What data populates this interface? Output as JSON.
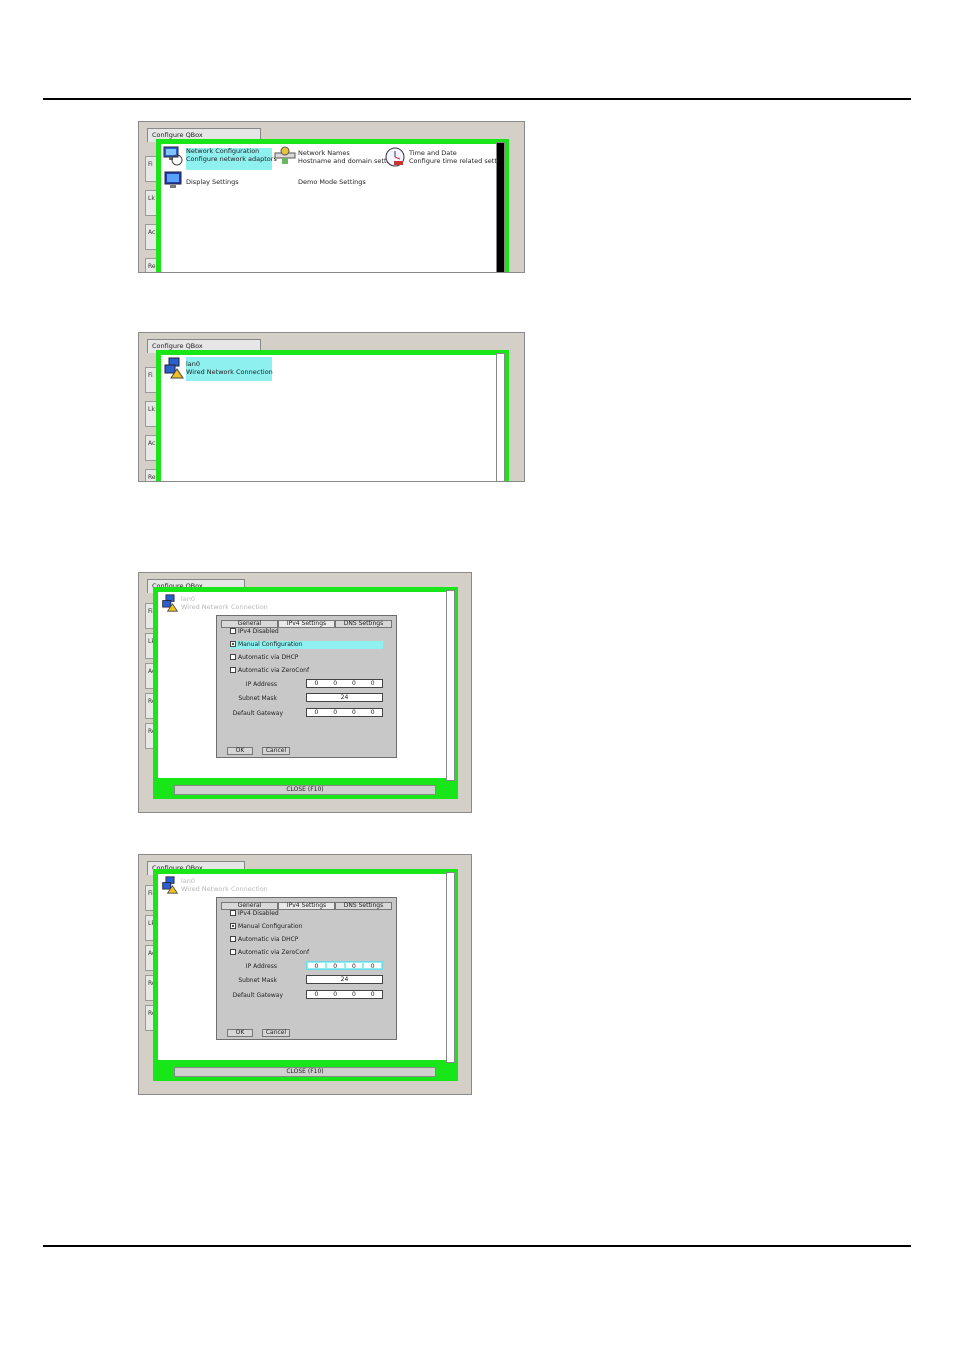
{
  "window_title": "Configure QBox",
  "side_tabs": [
    "Fi",
    "Lk",
    "Ac",
    "Re",
    "Re"
  ],
  "shot1": {
    "items": [
      {
        "title": "Network Configuration",
        "subtitle": "Configure network adaptors",
        "icon": "network-config-icon"
      },
      {
        "title": "Network Names",
        "subtitle": "Hostname and domain settin",
        "icon": "network-names-icon"
      },
      {
        "title": "Time and Date",
        "subtitle": "Configure time related settin",
        "icon": "clock-icon"
      },
      {
        "title": "Display Settings",
        "subtitle": "",
        "icon": "monitor-icon"
      },
      {
        "title": "Demo Mode Settings",
        "subtitle": "",
        "icon": ""
      }
    ]
  },
  "shot2": {
    "item": {
      "title": "lan0",
      "subtitle": "Wired Network Connection",
      "icon": "network-warning-icon"
    }
  },
  "dialog": {
    "conn_title": "lan0",
    "conn_subtitle": "Wired Network Connection",
    "tabs": [
      "General",
      "IPv4 Settings",
      "DNS Settings"
    ],
    "options": [
      "IPv4 Disabled",
      "Manual Configuration",
      "Automatic via DHCP",
      "Automatic via ZeroConf"
    ],
    "ip_label": "IP Address",
    "mask_label": "Subnet Mask",
    "gateway_label": "Default Gateway",
    "ip_values": [
      "0",
      "0",
      "0",
      "0"
    ],
    "mask_value": "24",
    "gateway_values": [
      "0",
      "0",
      "0",
      "0"
    ],
    "ok": "OK",
    "cancel": "Cancel",
    "close": "CLOSE (F10)"
  }
}
